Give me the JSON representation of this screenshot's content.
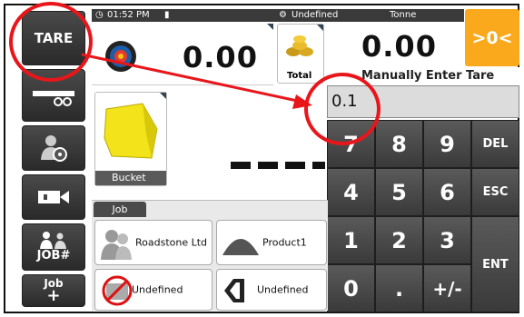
{
  "topbar": {
    "time": "01:52 PM",
    "status_label": "Undefined",
    "unit": "Tonne"
  },
  "sidebar": {
    "tare_label": "TARE",
    "job_number_label": "JOB#",
    "add_job_label": "Job",
    "add_job_plus": "+"
  },
  "zero_button": {
    "label": ">0<"
  },
  "weight": {
    "value": "0.00"
  },
  "total": {
    "value": "0.00",
    "label": "Total"
  },
  "bucket": {
    "label": "Bucket"
  },
  "tare_entry": {
    "title": "Manually Enter Tare",
    "value": "0.1"
  },
  "keypad": {
    "keys": [
      "7",
      "8",
      "9",
      "DEL",
      "4",
      "5",
      "6",
      "ESC",
      "1",
      "2",
      "3",
      "ENT",
      "0",
      ".",
      "+/-"
    ]
  },
  "job": {
    "tab_label": "Job",
    "customer": "Roadstone Ltd",
    "product": "Product1",
    "vehicle": "Undefined",
    "destination": "Undefined"
  },
  "colors": {
    "accent": "#f9a91b",
    "highlight": "#e8161b"
  }
}
